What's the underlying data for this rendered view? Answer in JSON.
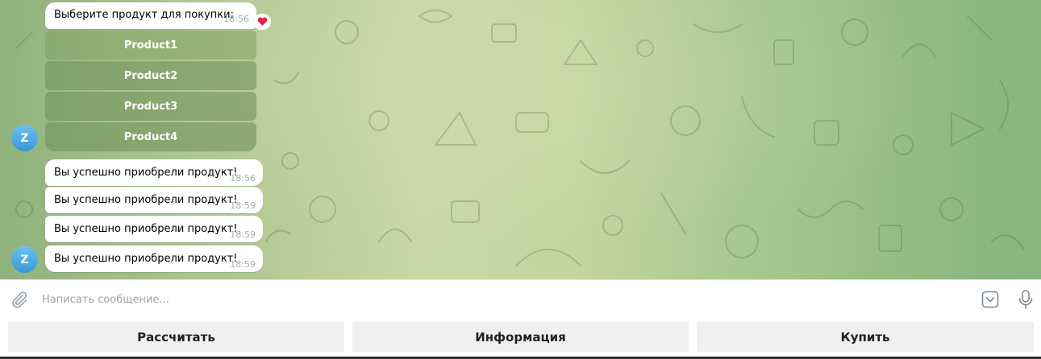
{
  "chat": {
    "messages": [
      {
        "text": "Выберите продукт для покупки:",
        "time": "18:56",
        "reaction": "❤️"
      },
      {
        "text": "Вы успешно приобрели продукт!",
        "time": "18:56"
      },
      {
        "text": "Вы успешно приобрели продукт!",
        "time": "18:59"
      },
      {
        "text": "Вы успешно приобрели продукт!",
        "time": "18:59"
      },
      {
        "text": "Вы успешно приобрели продукт!",
        "time": "18:59"
      }
    ],
    "inline_buttons": [
      "Product1",
      "Product2",
      "Product3",
      "Product4"
    ],
    "avatar_letter": "Z"
  },
  "composer": {
    "placeholder": "Написать сообщение..."
  },
  "reply_keyboard": {
    "buttons": [
      "Рассчитать",
      "Информация",
      "Купить"
    ]
  },
  "colors": {
    "bubble": "#ffffff",
    "time": "#a0acb6",
    "avatar": "#3a96d8",
    "inline_button": "#6e8c55"
  },
  "icons": {
    "attach": "paperclip-icon",
    "keyboard": "keyboard-toggle-icon",
    "mic": "microphone-icon",
    "reaction": "heart-icon"
  }
}
